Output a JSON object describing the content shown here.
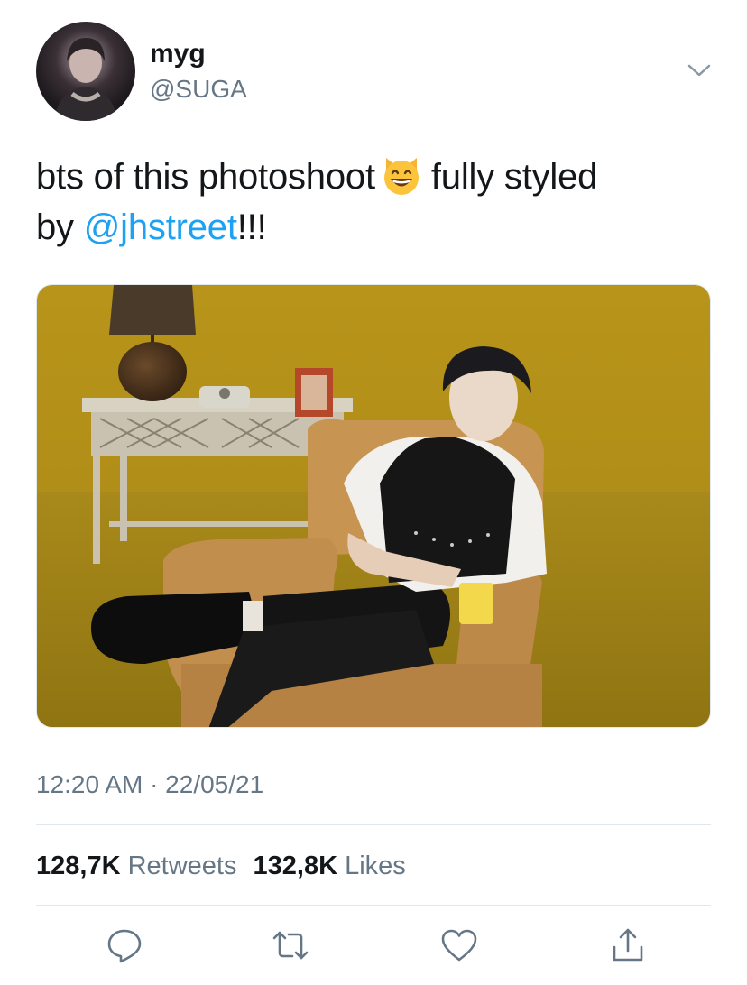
{
  "user": {
    "display_name": "myg",
    "handle": "@SUGA"
  },
  "tweet": {
    "text_part1": "bts of this photoshoot",
    "emoji": "grinning-cat-emoji",
    "text_part2": "fully styled",
    "text_part3": "by",
    "mention": "@jhstreet",
    "text_part4": "!!!"
  },
  "meta": {
    "timestamp": "12:20 AM · 22/05/21"
  },
  "stats": {
    "retweets_count": "128,7K",
    "retweets_label": "Retweets",
    "likes_count": "132,8K",
    "likes_label": "Likes"
  },
  "actions": [
    "reply-icon",
    "retweet-icon",
    "like-icon",
    "share-icon"
  ],
  "colors": {
    "link": "#1da1f2",
    "secondary_text": "#657786",
    "primary_text": "#14171a",
    "divider": "#e1e8ed"
  }
}
